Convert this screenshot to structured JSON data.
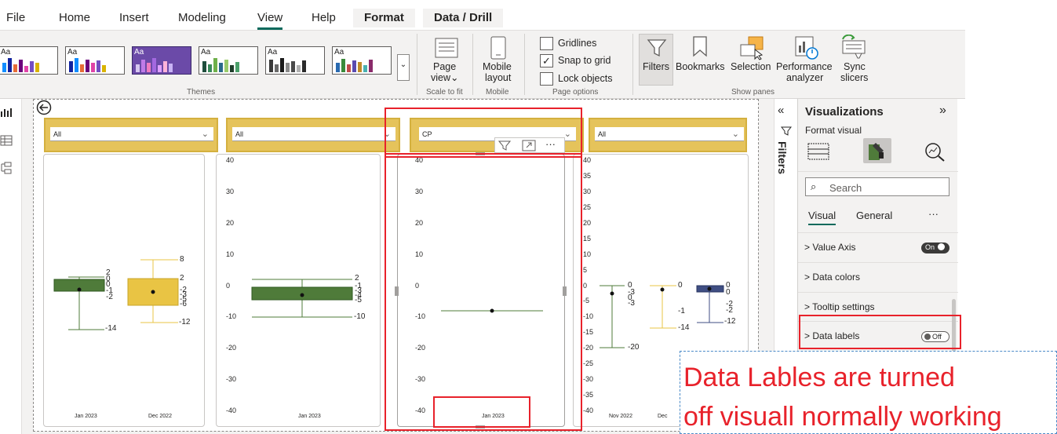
{
  "tabs": [
    "File",
    "Home",
    "Insert",
    "Modeling",
    "View",
    "Help",
    "Format",
    "Data / Drill"
  ],
  "themes": {
    "label": "Themes",
    "tile_text": "Aa"
  },
  "ribbon": {
    "scale_to_fit": {
      "label_1": "Page",
      "label_2": "view",
      "group": "Scale to fit"
    },
    "mobile": {
      "label_1": "Mobile",
      "label_2": "layout",
      "group": "Mobile"
    },
    "page_options": {
      "gridlines": "Gridlines",
      "snap": "Snap to grid",
      "lock": "Lock objects",
      "group": "Page options"
    },
    "show_panes": {
      "filters": "Filters",
      "bookmarks": "Bookmarks",
      "selection": "Selection",
      "performance_1": "Performance",
      "performance_2": "analyzer",
      "sync_1": "Sync",
      "sync_2": "slicers",
      "group": "Show panes"
    }
  },
  "slicers": [
    "All",
    "All",
    "CP",
    "All"
  ],
  "charts": {
    "y_ticks_a": [
      "40",
      "30",
      "20",
      "10",
      "0",
      "-10",
      "-20",
      "-30",
      "-40"
    ],
    "y_ticks_b": [
      "40",
      "35",
      "30",
      "25",
      "20",
      "15",
      "10",
      "5",
      "0",
      "-5",
      "-10",
      "-15",
      "-20",
      "-25",
      "-30",
      "-35",
      "-40"
    ],
    "chart1": {
      "x_labels": [
        "Jan 2023",
        "Dec 2022"
      ],
      "box1_labels": [
        "2",
        "0",
        "0",
        "-1",
        "-2"
      ],
      "box1_min": "-14",
      "box2_labels": [
        "8",
        "2",
        "-2",
        "-3",
        "-5",
        "-6"
      ],
      "box2_min": "-12"
    },
    "chart2": {
      "x_labels": [
        "Jan 2023"
      ],
      "labels": [
        "2",
        "-1",
        "-3",
        "-4",
        "-5"
      ],
      "min": "-10"
    },
    "chart3": {
      "x_labels": [
        "Jan 2023"
      ]
    },
    "chart4": {
      "x_labels": [
        "Nov 2022",
        "Dec"
      ],
      "box1_labels": [
        "0",
        "-3",
        "0",
        "-3"
      ],
      "box1_min": "-20",
      "box2_labels": [
        "0",
        "-1"
      ],
      "box2_min": "-14",
      "box3_labels": [
        "0",
        "0",
        "-2",
        "-2"
      ],
      "box3_min": "-12"
    }
  },
  "visualizations": {
    "title": "Visualizations",
    "subtitle": "Format visual",
    "search_placeholder": "Search",
    "tab_visual": "Visual",
    "tab_general": "General",
    "more": "···",
    "rows": [
      {
        "label": "Value Axis",
        "toggle": "On"
      },
      {
        "label": "Data colors"
      },
      {
        "label": "Tooltip settings"
      },
      {
        "label": "Data labels",
        "toggle": "Off"
      }
    ]
  },
  "filters_pane": {
    "label": "Filters"
  },
  "annotation": {
    "line1": "Data Lables are turned",
    "line2": "off visuall normally working"
  },
  "colors": {
    "green": "#4f7b3a",
    "yellow": "#e9c444",
    "navy": "#3f4e83",
    "accent_teal": "#0b6a5c",
    "highlight_red": "#e8222b"
  }
}
